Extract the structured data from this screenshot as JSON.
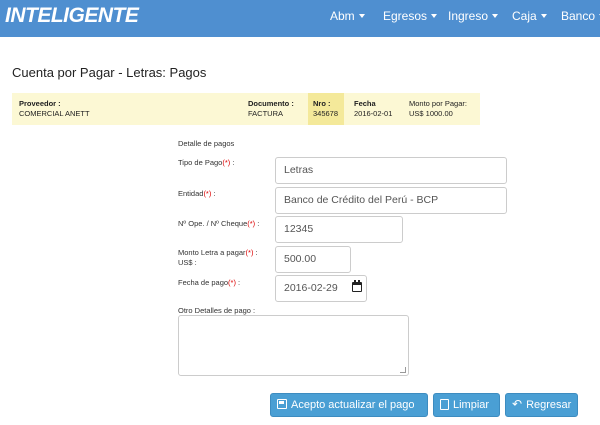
{
  "brand": {
    "part1": "INTELI",
    "part2": "GENTE"
  },
  "nav": [
    "Abm",
    "Egresos",
    "Ingreso",
    "Caja",
    "Banco"
  ],
  "page_title": "Cuenta por Pagar - Letras: Pagos",
  "info": {
    "proveedor_label": "Proveedor :",
    "proveedor_value": "COMERCIAL ANETT",
    "documento_label": "Documento :",
    "documento_value": "FACTURA",
    "nro_label": "Nro :",
    "nro_value": "345678",
    "fecha_label": "Fecha",
    "fecha_value": "2016-02-01",
    "monto_label": "Monto por Pagar:",
    "monto_value": "US$ 1000.00"
  },
  "form": {
    "section_title": "Detalle de pagos",
    "tipo_label": "Tipo de Pago",
    "tipo_value": "Letras",
    "entidad_label": "Entidad",
    "entidad_value": "Banco de Crédito del Perú -  BCP",
    "nope_label": "Nº Ope. / Nº Cheque",
    "nope_value": "12345",
    "monto_label": "Monto Letra a pagar",
    "monto_label2": "US$ :",
    "monto_value": "500.00",
    "fecha_label": "Fecha de pago",
    "fecha_value": "2016-02-29",
    "otro_label": "Otro Detalles de pago :",
    "otro_value": "",
    "required_mark": "(*)",
    "colon": " :"
  },
  "buttons": {
    "accept": "Acepto actualizar el pago",
    "clear": "Limpiar",
    "back": "Regresar"
  },
  "icons": {
    "save": "floppy-disk-icon",
    "clear": "file-icon",
    "back": "undo-arrow-icon",
    "calendar": "calendar-icon"
  },
  "colors": {
    "navbar": "#4f8fd0",
    "info_bar": "#fcf8d4",
    "info_highlight": "#f4e99a",
    "button": "#4a9fd4",
    "required": "#dd0000"
  }
}
